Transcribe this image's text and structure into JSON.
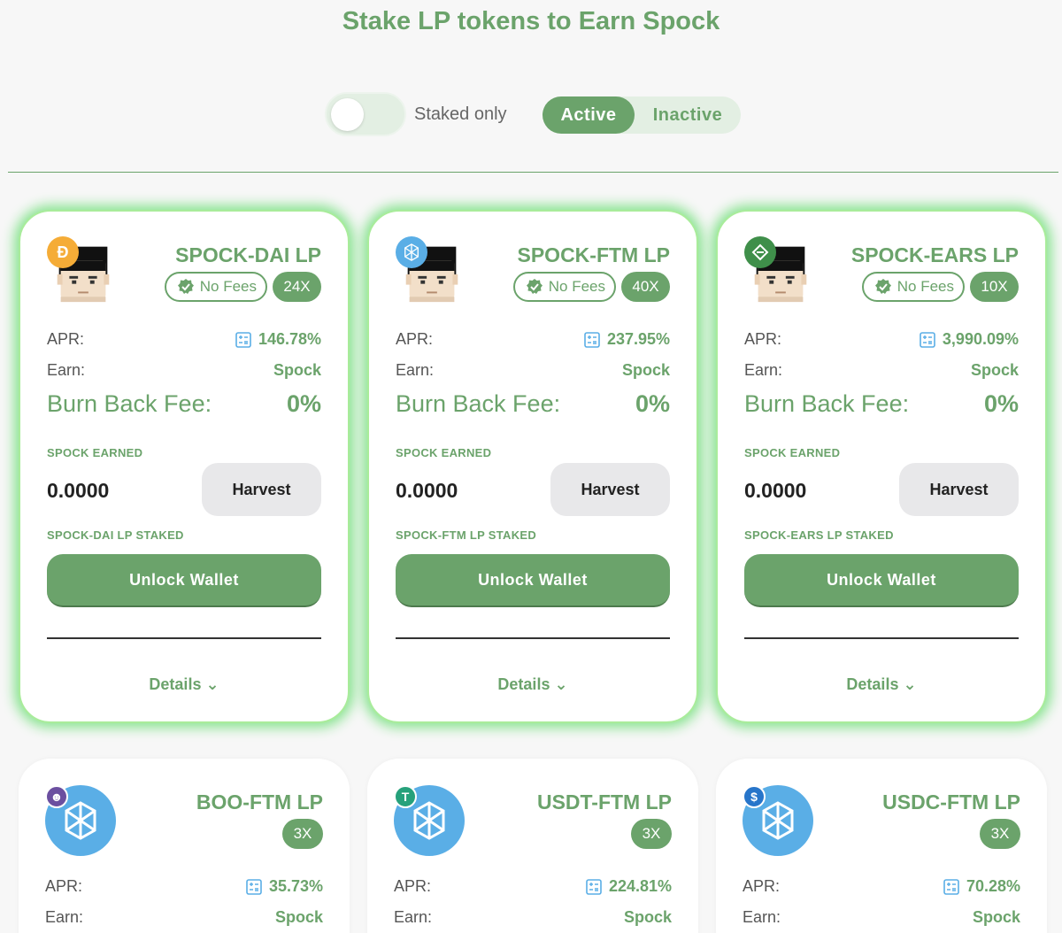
{
  "header": {
    "title": "Stake LP tokens to Earn Spock"
  },
  "filters": {
    "staked_only_label": "Staked only",
    "active_label": "Active",
    "inactive_label": "Inactive"
  },
  "labels": {
    "apr": "APR:",
    "earn": "Earn:",
    "burn_back_fee": "Burn Back Fee:",
    "spock_earned": "SPOCK EARNED",
    "harvest": "Harvest",
    "unlock_wallet": "Unlock Wallet",
    "details": "Details",
    "no_fees": "No Fees"
  },
  "colors": {
    "accent": "#6ba36b",
    "glow": "#87e38f",
    "fantom_blue": "#5aaee6"
  },
  "farms": [
    {
      "title": "SPOCK-DAI LP",
      "multiplier": "24X",
      "apr": "146.78%",
      "earn": "Spock",
      "burn_fee": "0%",
      "earned": "0.0000",
      "staked_label": "SPOCK-DAI LP STAKED",
      "token_icon": "dai-icon",
      "token_color": "#f5ac37"
    },
    {
      "title": "SPOCK-FTM LP",
      "multiplier": "40X",
      "apr": "237.95%",
      "earn": "Spock",
      "burn_fee": "0%",
      "earned": "0.0000",
      "staked_label": "SPOCK-FTM LP STAKED",
      "token_icon": "fantom-icon",
      "token_color": "#5aaee6"
    },
    {
      "title": "SPOCK-EARS LP",
      "multiplier": "10X",
      "apr": "3,990.09%",
      "earn": "Spock",
      "burn_fee": "0%",
      "earned": "0.0000",
      "staked_label": "SPOCK-EARS LP STAKED",
      "token_icon": "ears-icon",
      "token_color": "#3f8f4a"
    },
    {
      "title": "BOO-FTM LP",
      "multiplier": "3X",
      "apr": "35.73%",
      "earn": "Spock",
      "token_icon": "boo-icon",
      "token_color": "#6b4fa0"
    },
    {
      "title": "USDT-FTM LP",
      "multiplier": "3X",
      "apr": "224.81%",
      "earn": "Spock",
      "token_icon": "usdt-icon",
      "token_color": "#26a17b"
    },
    {
      "title": "USDC-FTM LP",
      "multiplier": "3X",
      "apr": "70.28%",
      "earn": "Spock",
      "token_icon": "usdc-icon",
      "token_color": "#2775ca"
    }
  ]
}
